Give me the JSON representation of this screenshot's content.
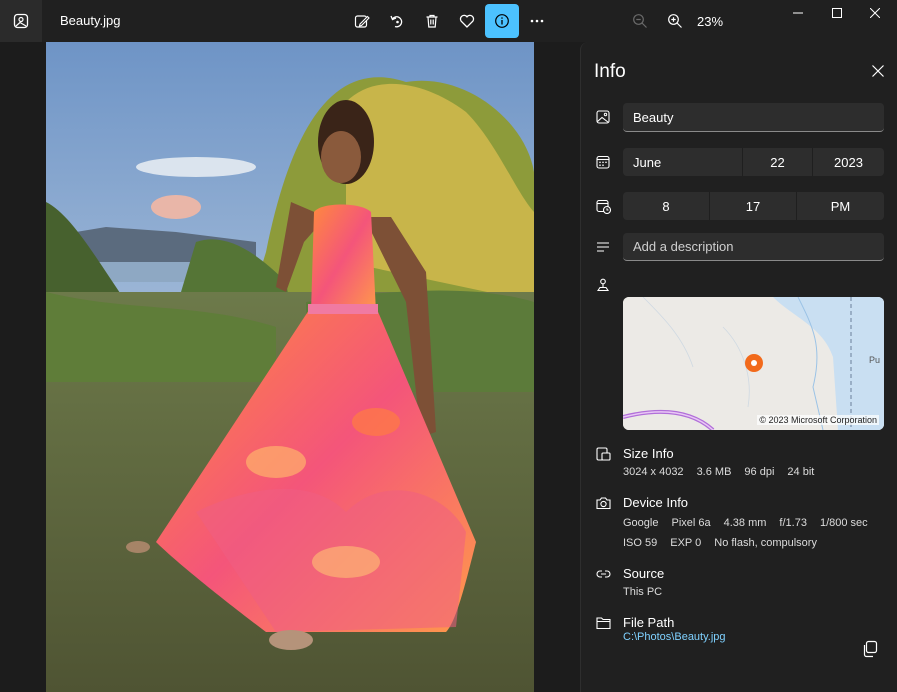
{
  "window": {
    "title": "Beauty.jpg",
    "zoom": "23%"
  },
  "toolbar": {
    "icons": [
      "edit-image-icon",
      "rotate-icon",
      "delete-icon",
      "favorite-heart-icon",
      "info-icon",
      "more-icon"
    ],
    "active": "info-icon",
    "accent": "#4cc2ff"
  },
  "info": {
    "heading": "Info",
    "title_value": "Beauty",
    "date": {
      "month": "June",
      "day": "22",
      "year": "2023"
    },
    "time": {
      "hour": "8",
      "minute": "17",
      "ampm": "PM"
    },
    "description_placeholder": "Add a description",
    "map_copyright": "© 2023 Microsoft Corporation",
    "map_label": "Pu",
    "size": {
      "title": "Size Info",
      "dimensions": "3024 x 4032",
      "file_size": "3.6 MB",
      "dpi": "96 dpi",
      "bit": "24 bit"
    },
    "device": {
      "title": "Device Info",
      "make": "Google",
      "model": "Pixel 6a",
      "focal": "4.38 mm",
      "aperture": "f/1.73",
      "shutter": "1/800 sec",
      "iso": "ISO 59",
      "exp": "EXP 0",
      "flash": "No flash, compulsory"
    },
    "source": {
      "title": "Source",
      "value": "This PC"
    },
    "file_path": {
      "title": "File Path",
      "value": "C:\\Photos\\Beauty.jpg"
    }
  }
}
